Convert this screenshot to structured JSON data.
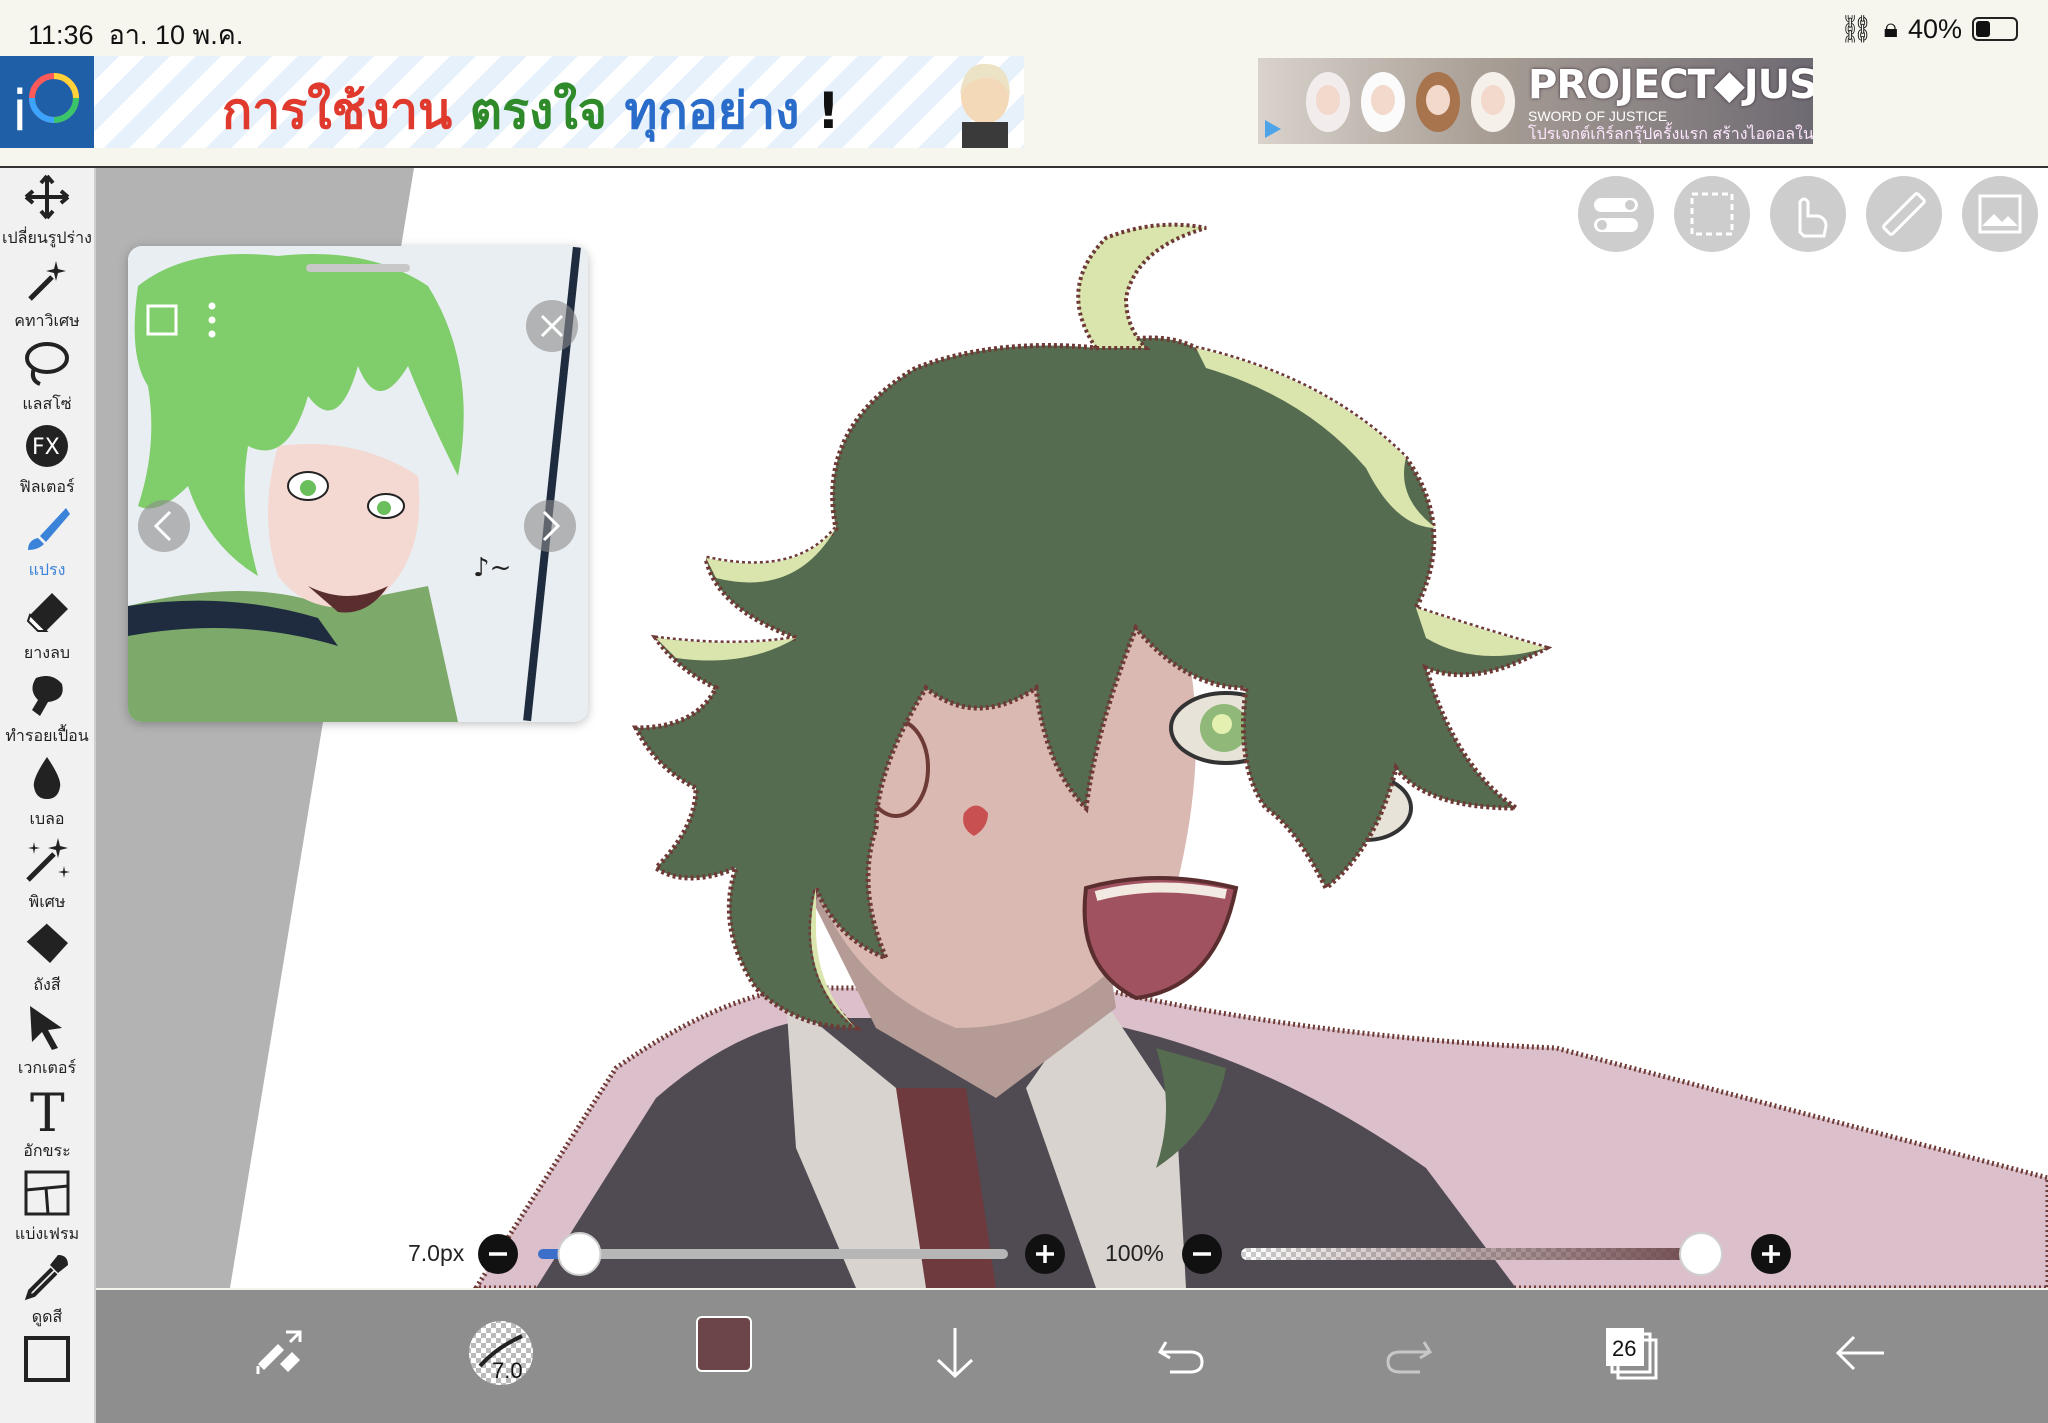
{
  "status": {
    "time": "11:36",
    "date": "อา. 10 พ.ค.",
    "battery": "40%"
  },
  "ads": {
    "banner1_parts": [
      "การใช้งาน",
      "ตรงใจ",
      "ทุกอย่าง",
      "!"
    ],
    "banner1_colors": [
      "#e03a2e",
      "#2f8a2a",
      "#2a6cc9",
      "#111111"
    ],
    "banner2_title": "PROJECT◆JUSTICE",
    "banner2_sub": "SWORD OF JUSTICE",
    "banner2_tag": "โปรเจกต์เกิร์ลกรุ๊ปครั้งแรก สร้างไอดอลในฝัน"
  },
  "tools": [
    {
      "id": "transform",
      "label": "เปลี่ยนรูปร่าง",
      "icon": "move-arrows-icon"
    },
    {
      "id": "magic-wand",
      "label": "คทาวิเศษ",
      "icon": "magic-wand-icon"
    },
    {
      "id": "lasso",
      "label": "แลสโซ่",
      "icon": "lasso-icon"
    },
    {
      "id": "filter",
      "label": "ฟิลเตอร์",
      "icon": "fx-icon"
    },
    {
      "id": "brush",
      "label": "แปรง",
      "icon": "brush-icon",
      "active": true
    },
    {
      "id": "eraser",
      "label": "ยางลบ",
      "icon": "eraser-icon"
    },
    {
      "id": "smudge",
      "label": "ทำรอยเปื้อน",
      "icon": "smudge-icon"
    },
    {
      "id": "blur",
      "label": "เบลอ",
      "icon": "blur-drop-icon"
    },
    {
      "id": "special",
      "label": "พิเศษ",
      "icon": "sparkle-icon"
    },
    {
      "id": "fill",
      "label": "ถังสี",
      "icon": "bucket-icon"
    },
    {
      "id": "vector",
      "label": "เวกเตอร์",
      "icon": "cursor-arrow-icon"
    },
    {
      "id": "text",
      "label": "อักขระ",
      "icon": "text-t-icon"
    },
    {
      "id": "frame",
      "label": "แบ่งเฟรม",
      "icon": "frame-divider-icon"
    },
    {
      "id": "eyedropper",
      "label": "ดูดสี",
      "icon": "eyedropper-icon"
    }
  ],
  "brush": {
    "size_label": "7.0px",
    "size_value": 0.05,
    "opacity_label": "100%",
    "opacity_value": 1.0
  },
  "bottom": {
    "brush_size_badge": "7.0",
    "current_color": "#6b4548",
    "layer_count": "26"
  },
  "colors": {
    "accent": "#3b83d9",
    "bar": "#8e8e8e",
    "hair": "#566c50",
    "hair_light": "#d9e5ad",
    "skin": "#d9b9b2",
    "jacket": "#504a52",
    "line": "#6e3a36"
  }
}
